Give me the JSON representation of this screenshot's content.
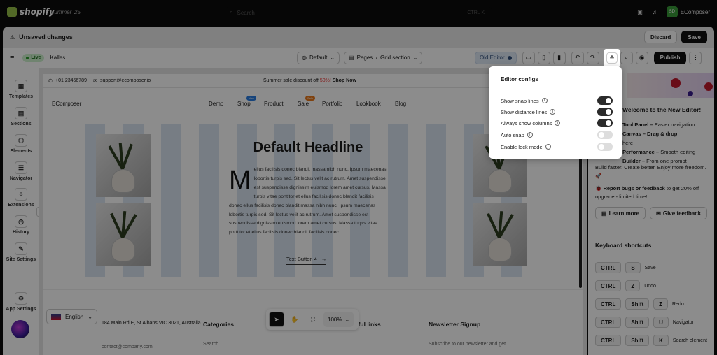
{
  "topbar": {
    "brand": "shopify",
    "store": "Summer '25",
    "search_placeholder": "Search",
    "shortcut": "CTRL K",
    "avatar_initials": "SD",
    "user": "EComposer"
  },
  "unsaved": {
    "title": "Unsaved changes",
    "discard": "Discard",
    "save": "Save"
  },
  "toolbar": {
    "live": "Live",
    "theme": "Kalles",
    "template": "Default",
    "pages": "Pages",
    "section": "Grid section",
    "old_editor": "Old Editor",
    "publish": "Publish"
  },
  "left_sidebar": [
    {
      "label": "Templates",
      "icon": "templates-icon"
    },
    {
      "label": "Sections",
      "icon": "sections-icon"
    },
    {
      "label": "Elements",
      "icon": "elements-icon"
    },
    {
      "label": "Navigator",
      "icon": "navigator-icon"
    },
    {
      "label": "Extensions",
      "icon": "extensions-icon"
    },
    {
      "label": "History",
      "icon": "history-icon"
    },
    {
      "label": "Site Settings",
      "icon": "site-settings-icon"
    },
    {
      "label": "App Settings",
      "icon": "app-settings-icon"
    }
  ],
  "page": {
    "phone": "+01 23456789",
    "email": "support@ecomposer.io",
    "promo_text": "Summer sale discount off",
    "promo_pct": "50%!",
    "promo_link": "Shop Now",
    "logo": "EComposer",
    "nav": [
      {
        "label": "Demo"
      },
      {
        "label": "Shop",
        "badge": "New"
      },
      {
        "label": "Product"
      },
      {
        "label": "Sale",
        "badge": "Sale"
      },
      {
        "label": "Portfolio"
      },
      {
        "label": "Lookbook"
      },
      {
        "label": "Blog"
      }
    ],
    "headline": "Default Headline",
    "dropcap": "M",
    "body_first": "ellus facilisis donec blandit massa nibh nunc. Ipsum maecenas lobortis turpis sed. Sit lectus velit ac rutrum. Amet suspendisse est suspendisse dignissim",
    "body_rest": "euismod lorem amet cursus. Massa turpis vitae porttitor et ellus facilisis donec blandit facilisis donec ellus facilisis donec blandit massa nibh nunc. Ipsum maecenas lobortis turpis sed. Sit lectus velit ac rutrum. Amet suspendisse est suspendisse dignissim euismod lorem amet cursus. Massa turpis vitae porttitor et ellus facilisis donec blandit facilisis donec",
    "text_button": "Text Button 4",
    "address": "184 Main Rd E, St Albans VIC 3021, Australia",
    "contact": "contact@company.com",
    "categories": "Categories",
    "search": "Search",
    "useful": "Useful links",
    "newsletter": "Newsletter Signup",
    "newsletter_sub": "Subscribe to our newsletter and get"
  },
  "language": "English",
  "zoom": "100%",
  "right_panel": {
    "welcome": "Welcome to the New Editor!",
    "items": [
      {
        "bold": "Tool Panel –",
        "text": " Easier navigation"
      },
      {
        "bold": "Canvas – Drag & drop",
        "text": ""
      },
      {
        "bold": "",
        "text": "here"
      },
      {
        "bold": "Performance –",
        "text": " Smooth editing"
      },
      {
        "bold": "Builder –",
        "text": " From one prompt"
      }
    ],
    "tagline": "Build faster. Create better. Enjoy more freedom. 🚀",
    "report_bold": "Report bugs or feedback",
    "report_text": " to get 20% off upgrade",
    "report_tail": " - limited time!",
    "learn_more": "Learn more",
    "give_feedback": "Give feedback",
    "shortcuts_title": "Keyboard shortcuts",
    "shortcuts": [
      {
        "keys": [
          "CTRL",
          "S"
        ],
        "label": "Save"
      },
      {
        "keys": [
          "CTRL",
          "Z"
        ],
        "label": "Undo"
      },
      {
        "keys": [
          "CTRL",
          "Shift",
          "Z"
        ],
        "label": "Redo"
      },
      {
        "keys": [
          "CTRL",
          "Shift",
          "U"
        ],
        "label": "Navigator"
      },
      {
        "keys": [
          "CTRL",
          "Shift",
          "K"
        ],
        "label": "Search element"
      }
    ]
  },
  "editor_configs": {
    "title": "Editor configs",
    "options": [
      {
        "label": "Show snap lines",
        "on": true
      },
      {
        "label": "Show distance lines",
        "on": true
      },
      {
        "label": "Always show columns",
        "on": true
      },
      {
        "label": "Auto snap",
        "on": false
      },
      {
        "label": "Enable lock mode",
        "on": false
      }
    ]
  }
}
